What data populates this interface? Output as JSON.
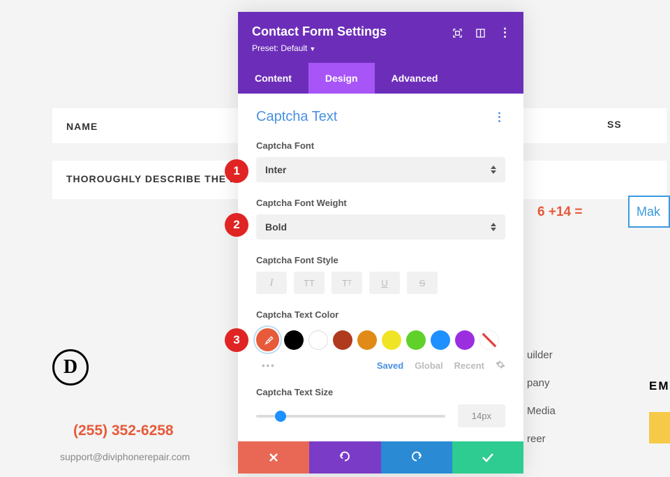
{
  "background": {
    "name_label": "NAME",
    "address_label": "SS",
    "describe_label": "THOROUGHLY DESCRIBE THE I",
    "captcha_question": "6 +14 =",
    "make_btn": "Mak",
    "logo_letter": "D",
    "phone": "(255) 352-6258",
    "email": "support@diviphonerepair.com",
    "em": "EM",
    "footer": {
      "built": "uilder",
      "company": "pany",
      "media": "Media",
      "reer": "reer"
    }
  },
  "modal": {
    "title": "Contact Form Settings",
    "preset": "Preset: Default",
    "tabs": {
      "content": "Content",
      "design": "Design",
      "advanced": "Advanced"
    },
    "section_title": "Captcha Text",
    "captcha_font": {
      "label": "Captcha Font",
      "value": "Inter"
    },
    "captcha_weight": {
      "label": "Captcha Font Weight",
      "value": "Bold"
    },
    "captcha_style": {
      "label": "Captcha Font Style"
    },
    "captcha_color": {
      "label": "Captcha Text Color",
      "swatches": [
        "#e75a3a",
        "#000000",
        "#ffffff",
        "#b03a1e",
        "#e08b17",
        "#f0e426",
        "#5fd12a",
        "#1e90ff",
        "#9b2fe0",
        "none"
      ],
      "sublinks": {
        "saved": "Saved",
        "global": "Global",
        "recent": "Recent"
      }
    },
    "captcha_size": {
      "label": "Captcha Text Size",
      "value": "14px"
    }
  },
  "markers": {
    "1": "1",
    "2": "2",
    "3": "3"
  }
}
